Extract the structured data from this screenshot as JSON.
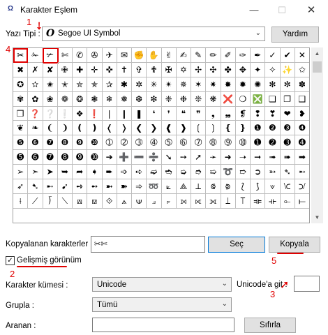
{
  "window": {
    "title": "Karakter Eşlem",
    "icon": "character-map-app-icon",
    "minimize_glyph": "—",
    "maximize_glyph": "☐",
    "close_glyph": "✕"
  },
  "font_row": {
    "label": "Yazı Tipi :",
    "font_icon_glyph": "O",
    "font_value": "Segoe UI Symbol",
    "help_button": "Yardım"
  },
  "grid": {
    "rows": [
      [
        "✂",
        "✁",
        "✃",
        "✄",
        "✆",
        "✇",
        "✈",
        "✉",
        "✊",
        "✋",
        "✌",
        "✍",
        "✎",
        "✏",
        "✐",
        "✑",
        "✒",
        "✓",
        "✔",
        "✕"
      ],
      [
        "✖",
        "✗",
        "✘",
        "✙",
        "✚",
        "✛",
        "✜",
        "✝",
        "✞",
        "✟",
        "✠",
        "✡",
        "✢",
        "✣",
        "✤",
        "✥",
        "✦",
        "✧",
        "✨",
        "✩"
      ],
      [
        "✪",
        "✫",
        "✬",
        "✭",
        "✮",
        "✯",
        "✰",
        "✱",
        "✲",
        "✳",
        "✴",
        "✵",
        "✶",
        "✷",
        "✸",
        "✹",
        "✺",
        "✻",
        "✼",
        "✽"
      ],
      [
        "✾",
        "✿",
        "❀",
        "❁",
        "❂",
        "❃",
        "❄",
        "❅",
        "❆",
        "❇",
        "❈",
        "❉",
        "❊",
        "❋",
        "❌",
        "❍",
        "❎",
        "❏",
        "❐",
        "❑"
      ],
      [
        "❒",
        "❓",
        "❔",
        "❕",
        "❖",
        "❗",
        "❘",
        "❙",
        "❚",
        "❛",
        "❜",
        "❝",
        "❞",
        "❟",
        "❠",
        "❡",
        "❢",
        "❣",
        "❤",
        "❥"
      ],
      [
        "❦",
        "❧",
        "❨",
        "❩",
        "❪",
        "❫",
        "❬",
        "❭",
        "❮",
        "❯",
        "❰",
        "❱",
        "❲",
        "❳",
        "❴",
        "❵",
        "❶",
        "❷",
        "❸",
        "❹"
      ],
      [
        "❺",
        "❻",
        "❼",
        "❽",
        "❾",
        "❿",
        "➀",
        "➁",
        "➂",
        "➃",
        "➄",
        "➅",
        "➆",
        "➇",
        "➈",
        "➉",
        "➊",
        "➋",
        "➌",
        "➍"
      ],
      [
        "➎",
        "➏",
        "➐",
        "➑",
        "➒",
        "➓",
        "➔",
        "➕",
        "➖",
        "➗",
        "➘",
        "➙",
        "➚",
        "➛",
        "➜",
        "➝",
        "➞",
        "➟",
        "➠",
        "➡"
      ],
      [
        "➢",
        "➣",
        "➤",
        "➥",
        "➦",
        "➧",
        "➨",
        "➩",
        "➪",
        "➫",
        "➬",
        "➭",
        "➮",
        "➯",
        "➰",
        "➱",
        "➲",
        "➳",
        "➴",
        "➵"
      ],
      [
        "➶",
        "➷",
        "➸",
        "➹",
        "➺",
        "➻",
        "➼",
        "➽",
        "➾",
        "➿",
        "⟀",
        "⟁",
        "⟂",
        "⟃",
        "⟄",
        "⟅",
        "⟆",
        "⟇",
        "⟈",
        "⟉"
      ],
      [
        "⟊",
        "⟋",
        "⟌",
        "⟍",
        "⟎",
        "⟏",
        "⟐",
        "⟑",
        "⟒",
        "⟓",
        "⟔",
        "⟕",
        "⟖",
        "⟗",
        "⟘",
        "⟙",
        "⟚",
        "⟛",
        "⟜",
        "⟝"
      ]
    ],
    "selected_index": 0,
    "highlighted_index": 2
  },
  "copy_row": {
    "label": "Kopyalanan karakterler :",
    "value": "✂✄",
    "select_button": "Seç",
    "copy_button": "Kopyala"
  },
  "advanced": {
    "checkbox_label": "Gelişmiş görünüm",
    "checked": true,
    "check_glyph": "✓"
  },
  "charset_row": {
    "label": "Karakter kümesi :",
    "value": "Unicode",
    "goto_label": "Unicode'a git :",
    "goto_value": ""
  },
  "group_row": {
    "label": "Grupla :",
    "value": "Tümü"
  },
  "search_row": {
    "label": "Aranan :",
    "value": "",
    "search_button": "Sıfırla"
  },
  "annotations": [
    "1",
    "2",
    "3",
    "4",
    "5"
  ],
  "colors": {
    "annotation": "#e00000",
    "focus": "#0078d7"
  }
}
